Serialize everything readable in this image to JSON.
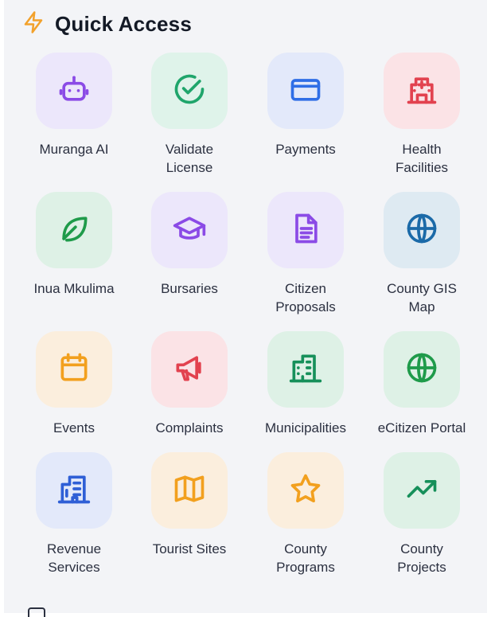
{
  "header": {
    "title": "Quick Access",
    "icon": "lightning-icon",
    "icon_color": "#f2a12b"
  },
  "tiles": [
    {
      "label": "Muranga AI",
      "icon": "robot-icon",
      "bg": "#ece7fb",
      "color": "#8b4be6"
    },
    {
      "label": "Validate\nLicense",
      "icon": "check-circle-icon",
      "bg": "#dff3ea",
      "color": "#1fa56b"
    },
    {
      "label": "Payments",
      "icon": "credit-card-icon",
      "bg": "#e3e9fa",
      "color": "#2f6ee6"
    },
    {
      "label": "Health\nFacilities",
      "icon": "hospital-icon",
      "bg": "#fbe3e6",
      "color": "#e2424f"
    },
    {
      "label": "Inua Mkulima",
      "icon": "leaf-icon",
      "bg": "#def1e6",
      "color": "#1f9b4a"
    },
    {
      "label": "Bursaries",
      "icon": "graduation-cap-icon",
      "bg": "#ece7fb",
      "color": "#8b4be6"
    },
    {
      "label": "Citizen\nProposals",
      "icon": "document-icon",
      "bg": "#ece7fb",
      "color": "#8b4be6"
    },
    {
      "label": "County GIS\nMap",
      "icon": "globe-icon",
      "bg": "#deeaf2",
      "color": "#1b6aa8"
    },
    {
      "label": "Events",
      "icon": "calendar-icon",
      "bg": "#fbeedd",
      "color": "#f2a01e"
    },
    {
      "label": "Complaints",
      "icon": "megaphone-icon",
      "bg": "#fbe3e6",
      "color": "#e2424f"
    },
    {
      "label": "Municipalities",
      "icon": "buildings-icon",
      "bg": "#def1e6",
      "color": "#16905a"
    },
    {
      "label": "eCitizen Portal",
      "icon": "globe-icon",
      "bg": "#def1e6",
      "color": "#1f9b4a"
    },
    {
      "label": "Revenue\nServices",
      "icon": "building-icon",
      "bg": "#e3e9fa",
      "color": "#2f5fd6"
    },
    {
      "label": "Tourist Sites",
      "icon": "map-icon",
      "bg": "#fbeedd",
      "color": "#f2a01e"
    },
    {
      "label": "County\nPrograms",
      "icon": "star-icon",
      "bg": "#fbeedd",
      "color": "#f2a01e"
    },
    {
      "label": "County\nProjects",
      "icon": "trending-up-icon",
      "bg": "#def1e6",
      "color": "#16905a"
    }
  ]
}
